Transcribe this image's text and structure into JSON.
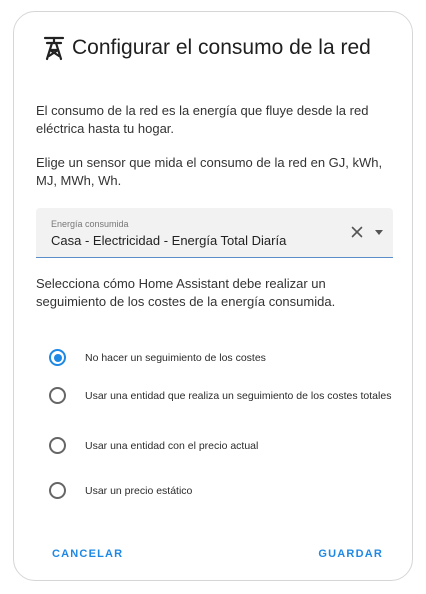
{
  "dialog": {
    "title": "Configurar el consumo de la red",
    "title_icon": "transmission-tower-icon",
    "description_1": "El consumo de la red es la energía que fluye desde la red eléctrica hasta tu hogar.",
    "description_2": "Elige un sensor que mida el consumo de la red en GJ, kWh, MJ, MWh, Wh.",
    "sensor_select": {
      "label": "Energía consumida",
      "value": "Casa - Electricidad - Energía Total Diaría"
    },
    "cost_prompt": "Selecciona cómo Home Assistant debe realizar un seguimiento de los costes de la energía consumida.",
    "cost_options": [
      {
        "label": "No hacer un seguimiento de los costes",
        "selected": true
      },
      {
        "label": "Usar una entidad que realiza un seguimiento de los costes totales",
        "selected": false
      },
      {
        "label": "Usar una entidad con el precio actual",
        "selected": false
      },
      {
        "label": "Usar un precio estático",
        "selected": false
      }
    ],
    "buttons": {
      "cancel": "Cancelar",
      "save": "Guardar"
    }
  },
  "colors": {
    "accent": "#1e88e5",
    "field_background": "#f2f2f2"
  }
}
